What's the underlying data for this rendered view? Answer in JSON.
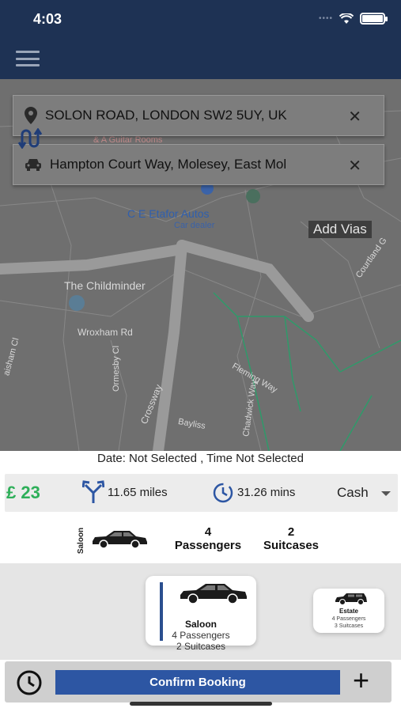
{
  "status_bar": {
    "time": "4:03"
  },
  "header": {
    "menu_icon": "hamburger-menu-icon"
  },
  "map": {
    "pickup": "SOLON ROAD, LONDON SW2 5UY, UK",
    "dropoff": "Hampton Court Way, Molesey, East Mol",
    "add_vias": "Add Vias",
    "labels": {
      "poi_name": "C E Etafor Autos",
      "poi_type": "Car dealer",
      "childminder": "The Childminder",
      "wroxham": "Wroxham Rd",
      "ormesby": "Ormesby Cl",
      "fleming": "Fleming Way",
      "crossway": "Crossway",
      "chadwick": "Chadwick Way",
      "bayliss": "Bayliss",
      "courtland": "Courtland G",
      "paisham": "aisham Cl",
      "guitar": "& A Guitar Rooms"
    }
  },
  "booking": {
    "date_time": "Date: Not Selected , Time  Not Selected",
    "price": "£ 23",
    "distance": "11.65 miles",
    "duration": "31.26 mins",
    "payment": "Cash",
    "summary": {
      "vehicle": "Saloon",
      "passengers_count": "4",
      "passengers_label": "Passengers",
      "suitcases_count": "2",
      "suitcases_label": "Suitcases"
    }
  },
  "vehicles": [
    {
      "name": "Saloon",
      "passengers": "4 Passengers",
      "suitcases": "2 Suitcases"
    },
    {
      "name": "Estate",
      "passengers": "4 Passengers",
      "suitcases": "3 Suitcases"
    }
  ],
  "footer": {
    "confirm_label": "Confirm Booking",
    "plus": "+"
  },
  "colors": {
    "header": "#1e3254",
    "price": "#2eaf59",
    "button": "#2d56a3"
  }
}
